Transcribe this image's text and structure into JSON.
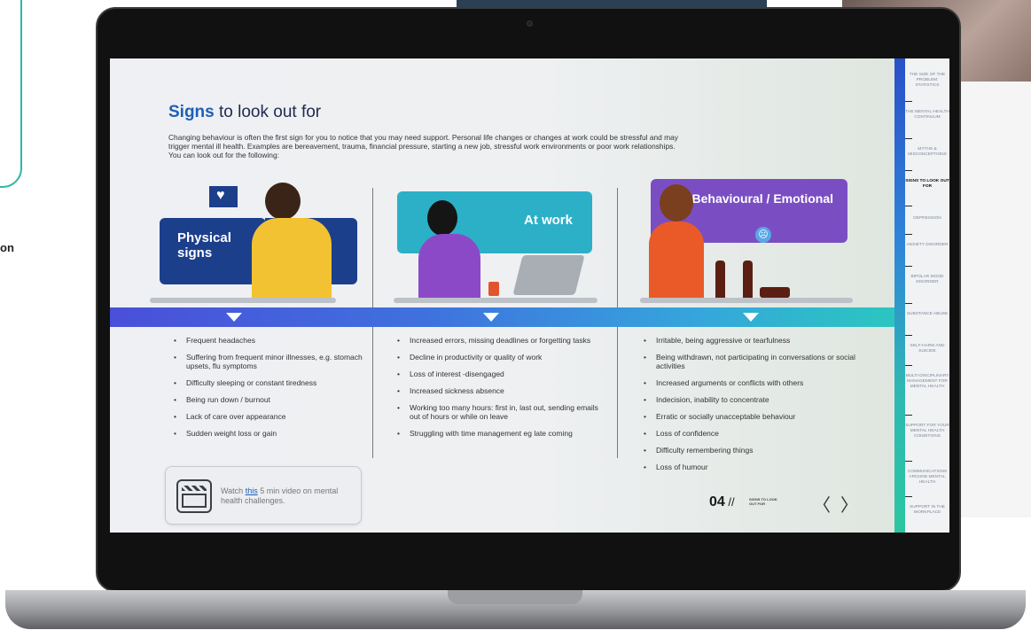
{
  "background": {
    "partial_label": "on"
  },
  "slide": {
    "title_strong": "Signs",
    "title_rest": " to look out for",
    "intro": "Changing behaviour is often the first sign for you to notice that you may need support. Personal life changes or changes at work could be stressful and may trigger mental ill health. Examples are bereavement, trauma, financial pressure, starting a new job, stressful work environments or poor work relationships. You can look out for the following:",
    "panels": [
      {
        "label": "Physical signs",
        "color": "#1c3f8c"
      },
      {
        "label": "At work",
        "color": "#2bb0c7"
      },
      {
        "label": "Behavioural / Emotional",
        "color": "#7a4ec2"
      }
    ],
    "lists": {
      "physical": [
        "Frequent headaches",
        "Suffering from frequent minor illnesses, e.g. stomach upsets, flu symptoms",
        "Difficulty sleeping or constant tiredness",
        "Being run down / burnout",
        "Lack of care over appearance",
        "Sudden weight loss or gain"
      ],
      "work": [
        "Increased errors, missing deadlines or forgetting tasks",
        "Decline in productivity or quality of work",
        "Loss of interest -disengaged",
        "Increased sickness absence",
        "Working too many hours: first in, last out, sending emails out of hours or while on leave",
        "Struggling with time management eg late coming"
      ],
      "behavioural": [
        "Irritable, being aggressive or tearfulness",
        "Being withdrawn, not participating in conversations or social activities",
        "Increased arguments or conflicts with others",
        "Indecision, inability to concentrate",
        "Erratic or socially unacceptable behaviour",
        "Loss of confidence",
        "Difficulty remembering things",
        "Loss of humour"
      ]
    },
    "video": {
      "prefix": "Watch ",
      "link": "this",
      "suffix": " 5 min video on mental health challenges."
    },
    "page": {
      "number": "04",
      "separator": " //",
      "section": "SIGNS TO LOOK OUT FOR",
      "prev": "〈",
      "next": "〉"
    }
  },
  "sidebar": {
    "items": [
      {
        "label": "THE SIZE OF THE PROBLEM: STATISTICS"
      },
      {
        "label": "THE MENTAL HEALTH CONTINUUM"
      },
      {
        "label": "MYTHS & MISCONCEPTIONS"
      },
      {
        "label": "SIGNS TO LOOK OUT FOR",
        "active": true
      },
      {
        "label": "DEPRESSION"
      },
      {
        "label": "ANXIETY DISORDER"
      },
      {
        "label": "BIPOLAR MOOD DISORDER"
      },
      {
        "label": "SUBSTANCE ABUSE"
      },
      {
        "label": "SELF-HARM AND SUICIDE"
      },
      {
        "label": "MULTI-DISCIPLINARY MANAGEMENT FOR MENTAL HEALTH"
      },
      {
        "label": "SUPPORT FOR YOUR MENTAL HEALTH CONDITIONS"
      },
      {
        "label": "COMMUNICATIONS AROUND MENTAL HEALTH"
      },
      {
        "label": "SUPPORT IN THE WORKPLACE"
      }
    ]
  }
}
